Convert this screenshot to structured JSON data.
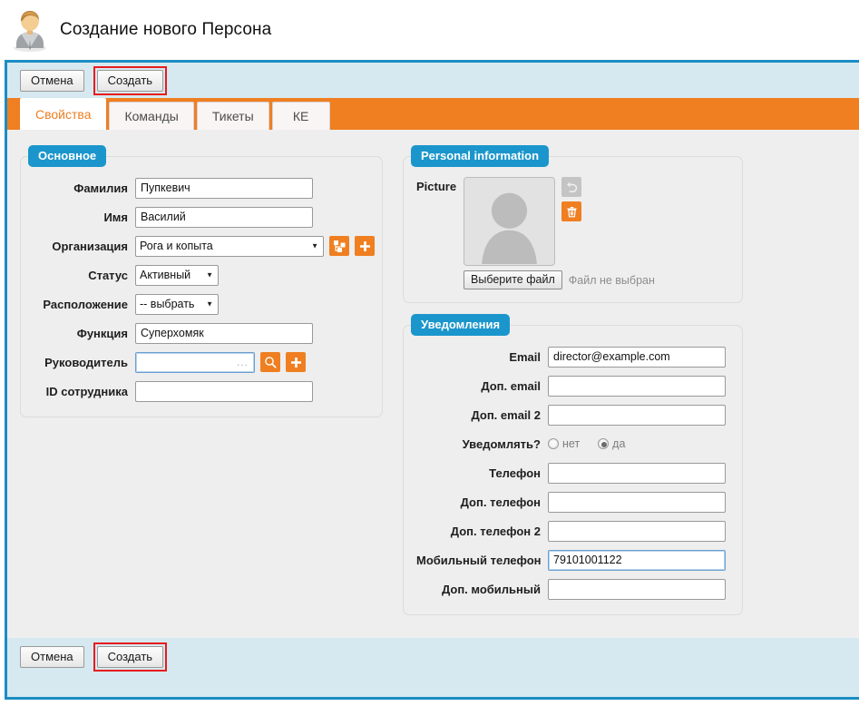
{
  "header": {
    "title": "Создание нового Персона",
    "avatar_icon": "person-avatar-icon"
  },
  "toolbar": {
    "cancel_label": "Отмена",
    "create_label": "Создать"
  },
  "bottom_toolbar": {
    "cancel_label": "Отмена",
    "create_label": "Создать"
  },
  "tabs": [
    {
      "label": "Свойства",
      "active": true
    },
    {
      "label": "Команды",
      "active": false
    },
    {
      "label": "Тикеты",
      "active": false
    },
    {
      "label": "КЕ",
      "active": false
    }
  ],
  "panels": {
    "main": {
      "legend": "Основное",
      "fields": {
        "lastname": {
          "label": "Фамилия",
          "value": "Пупкевич"
        },
        "firstname": {
          "label": "Имя",
          "value": "Василий"
        },
        "organization": {
          "label": "Организация",
          "value": "Рога и копыта"
        },
        "status": {
          "label": "Статус",
          "value": "Активный"
        },
        "location": {
          "label": "Расположение",
          "value": "-- выбрать --"
        },
        "function": {
          "label": "Функция",
          "value": "Суперхомяк"
        },
        "manager": {
          "label": "Руководитель",
          "value": "",
          "hint": "..."
        },
        "employee_id": {
          "label": "ID сотрудника",
          "value": ""
        }
      },
      "buttons": {
        "org_tree_icon": "hierarchy-tree-icon",
        "org_add_icon": "plus-icon",
        "manager_search_icon": "magnifier-icon",
        "manager_add_icon": "plus-icon"
      }
    },
    "personal": {
      "legend": "Personal information",
      "picture_label": "Picture",
      "file_button": "Выберите файл",
      "file_status": "Файл не выбран",
      "undo_icon": "undo-arrow-icon",
      "delete_icon": "trash-icon"
    },
    "notifications": {
      "legend": "Уведомления",
      "fields": {
        "email": {
          "label": "Email",
          "value": "director@example.com"
        },
        "email2": {
          "label": "Доп. email",
          "value": ""
        },
        "email3": {
          "label": "Доп. email 2",
          "value": ""
        },
        "phone": {
          "label": "Телефон",
          "value": ""
        },
        "phone2": {
          "label": "Доп. телефон",
          "value": ""
        },
        "phone3": {
          "label": "Доп. телефон 2",
          "value": ""
        },
        "mobile": {
          "label": "Мобильный телефон",
          "value": "79101001122"
        },
        "mobile2": {
          "label": "Доп. мобильный",
          "value": ""
        }
      },
      "notify": {
        "label": "Уведомлять?",
        "option_no": "нет",
        "option_yes": "да",
        "selected": "да"
      }
    }
  },
  "colors": {
    "window_border": "#1b8cc4",
    "toolbar_bg": "#d6e9f0",
    "tabbar_orange": "#ef7f21",
    "legend_blue": "#1b96cc",
    "content_bg": "#eeeeee",
    "highlight_red": "#e81c1c",
    "active_tab_text": "#ef7f21"
  }
}
